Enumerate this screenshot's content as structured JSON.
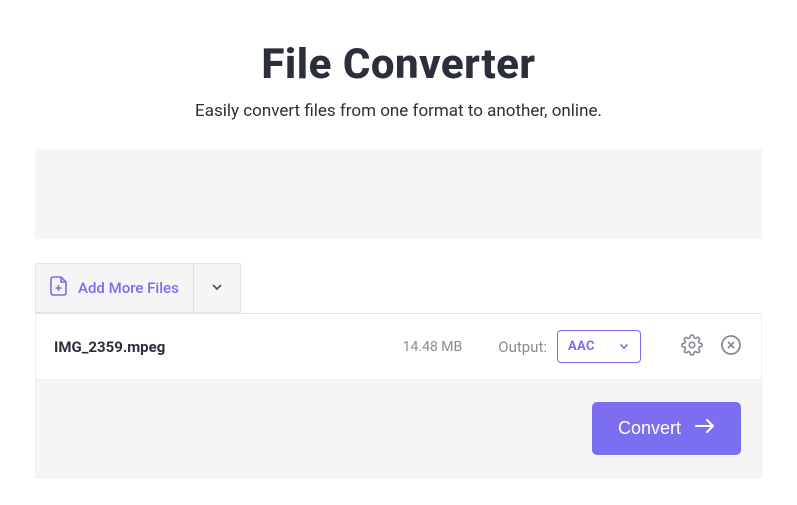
{
  "header": {
    "title": "File Converter",
    "subtitle": "Easily convert files from one format to another, online."
  },
  "toolbar": {
    "add_more_label": "Add More Files"
  },
  "file": {
    "name": "IMG_2359.mpeg",
    "size": "14.48 MB",
    "output_label": "Output:",
    "output_selected": "AAC"
  },
  "actions": {
    "convert_label": "Convert"
  },
  "colors": {
    "accent": "#7a6df0",
    "text_dark": "#2b2f3a",
    "text_muted": "#8a8a94",
    "panel_bg": "#f5f5f6"
  }
}
